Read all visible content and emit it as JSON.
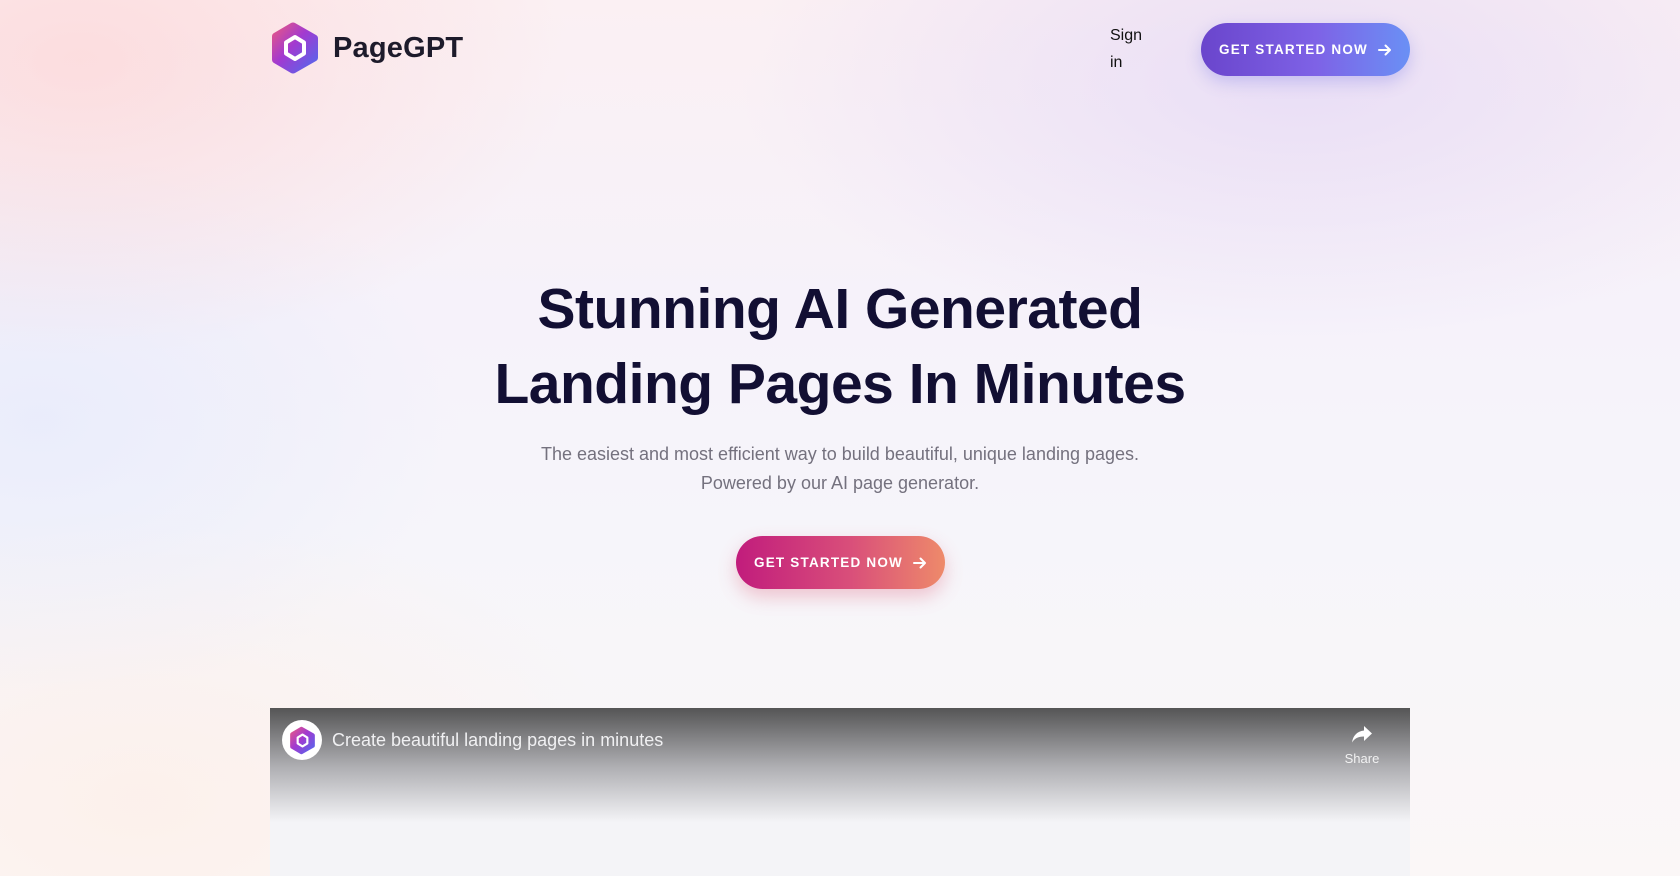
{
  "header": {
    "logo_text": "PageGPT",
    "logo_icon": "hexagon-logo-icon",
    "signin_label": "Sign in",
    "cta_label": "GET STARTED NOW",
    "cta_icon": "arrow-right-icon"
  },
  "hero": {
    "title_line1": "Stunning AI Generated",
    "title_line2": "Landing Pages In Minutes",
    "subtitle_line1": "The easiest and most efficient way to build beautiful, unique landing pages.",
    "subtitle_line2": "Powered by our AI page generator.",
    "cta_label": "GET STARTED NOW",
    "cta_icon": "arrow-right-icon"
  },
  "video": {
    "title": "Create beautiful landing pages in minutes",
    "share_label": "Share",
    "share_icon": "share-arrow-icon",
    "channel_icon": "hexagon-logo-icon"
  },
  "colors": {
    "header_cta_gradient": [
      "#6a45cc",
      "#7e62e6",
      "#6a90f5"
    ],
    "hero_cta_gradient": [
      "#c11c7c",
      "#d94f7a",
      "#ee8a6a"
    ],
    "title_color": "#120f33",
    "subtitle_color": "#74717e"
  }
}
